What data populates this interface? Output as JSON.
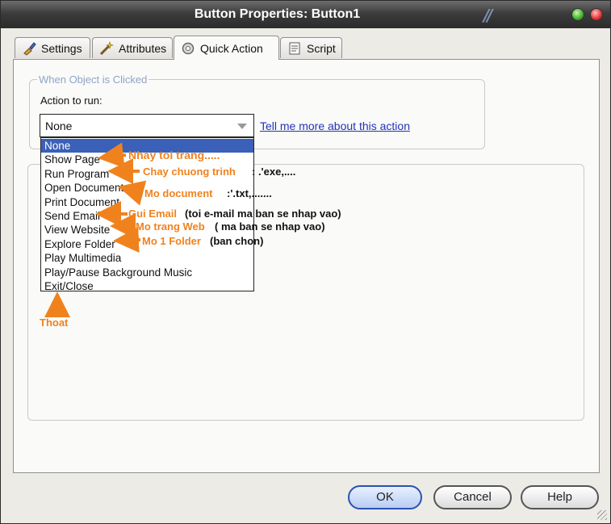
{
  "window": {
    "title": "Button Properties: Button1",
    "logo": "//"
  },
  "tabs": [
    {
      "label": "Settings",
      "icon": "brush-icon"
    },
    {
      "label": "Attributes",
      "icon": "wand-icon"
    },
    {
      "label": "Quick Action",
      "icon": "gear-icon"
    },
    {
      "label": "Script",
      "icon": "script-icon"
    }
  ],
  "quick_action": {
    "group_title": "When Object is Clicked",
    "action_label": "Action to run:",
    "selected_value": "None",
    "help_link": "Tell me more about this action",
    "options": [
      "None",
      "Show Page",
      "Run Program",
      "Open Document",
      "Print Document",
      "Send Email",
      "View Website",
      "Explore Folder",
      "Play Multimedia",
      "Play/Pause Background Music",
      "Exit/Close"
    ]
  },
  "annotations": {
    "show_page": "Nhay toi trang.....",
    "run_program": "Chay chuong trinh",
    "run_program_ext": ": .'exe,....",
    "open_document": "Mo document",
    "open_document_ext": ":'.txt,.......",
    "send_email": "Gui Email",
    "send_email_ext": "(toi e-mail ma ban se nhap vao)",
    "view_website": "Mo trang Web",
    "view_website_ext": "( ma ban se nhap vao)",
    "explore_folder": "Mo 1 Folder",
    "explore_folder_ext": "(ban chon)",
    "exit_close": "Thoat"
  },
  "buttons": {
    "ok": "OK",
    "cancel": "Cancel",
    "help": "Help"
  },
  "colors": {
    "annotation": "#f0821e",
    "selection": "#3a60b8",
    "link": "#2234b8",
    "ok_border": "#2b52b0"
  }
}
